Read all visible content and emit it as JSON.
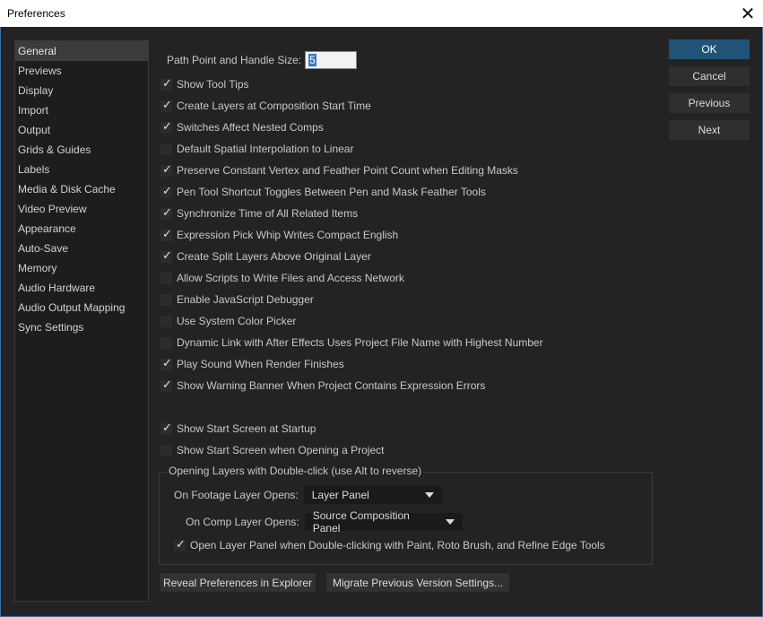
{
  "window": {
    "title": "Preferences",
    "close_glyph": "✕"
  },
  "sidebar": {
    "items": [
      {
        "label": "General",
        "active": true
      },
      {
        "label": "Previews"
      },
      {
        "label": "Display"
      },
      {
        "label": "Import"
      },
      {
        "label": "Output"
      },
      {
        "label": "Grids & Guides"
      },
      {
        "label": "Labels"
      },
      {
        "label": "Media & Disk Cache"
      },
      {
        "label": "Video Preview"
      },
      {
        "label": "Appearance"
      },
      {
        "label": "Auto-Save"
      },
      {
        "label": "Memory"
      },
      {
        "label": "Audio Hardware"
      },
      {
        "label": "Audio Output Mapping"
      },
      {
        "label": "Sync Settings"
      }
    ]
  },
  "general": {
    "path_point_label": "Path Point and Handle Size:",
    "path_point_value": "5",
    "checkboxes": [
      {
        "label": "Show Tool Tips",
        "checked": true
      },
      {
        "label": "Create Layers at Composition Start Time",
        "checked": true
      },
      {
        "label": "Switches Affect Nested Comps",
        "checked": true
      },
      {
        "label": "Default Spatial Interpolation to Linear",
        "checked": false
      },
      {
        "label": "Preserve Constant Vertex and Feather Point Count when Editing Masks",
        "checked": true
      },
      {
        "label": "Pen Tool Shortcut Toggles Between Pen and Mask Feather Tools",
        "checked": true
      },
      {
        "label": "Synchronize Time of All Related Items",
        "checked": true
      },
      {
        "label": "Expression Pick Whip Writes Compact English",
        "checked": true
      },
      {
        "label": "Create Split Layers Above Original Layer",
        "checked": true
      },
      {
        "label": "Allow Scripts to Write Files and Access Network",
        "checked": false
      },
      {
        "label": "Enable JavaScript Debugger",
        "checked": false
      },
      {
        "label": "Use System Color Picker",
        "checked": false
      },
      {
        "label": "Dynamic Link with After Effects Uses Project File Name with Highest Number",
        "checked": false
      },
      {
        "label": "Play Sound When Render Finishes",
        "checked": true
      },
      {
        "label": "Show Warning Banner When Project Contains Expression Errors",
        "checked": true
      }
    ],
    "startup_checkboxes": [
      {
        "label": "Show Start Screen at Startup",
        "checked": true
      },
      {
        "label": "Show Start Screen when Opening a Project",
        "checked": false
      }
    ],
    "opening_layers": {
      "title": "Opening Layers with Double-click (use Alt to reverse)",
      "footage_label": "On Footage Layer Opens:",
      "footage_value": "Layer Panel",
      "comp_label": "On Comp Layer Opens:",
      "comp_value": "Source Composition Panel",
      "open_panel_label": "Open Layer Panel when Double-clicking with Paint, Roto Brush, and Refine Edge Tools",
      "open_panel_checked": true
    },
    "reveal_button": "Reveal Preferences in Explorer",
    "migrate_button": "Migrate Previous Version Settings..."
  },
  "actions": {
    "ok": "OK",
    "cancel": "Cancel",
    "previous": "Previous",
    "next": "Next"
  },
  "colors": {
    "background": "#232323",
    "primary_button": "#1f5377",
    "sidebar_active": "#3c3c3c"
  }
}
